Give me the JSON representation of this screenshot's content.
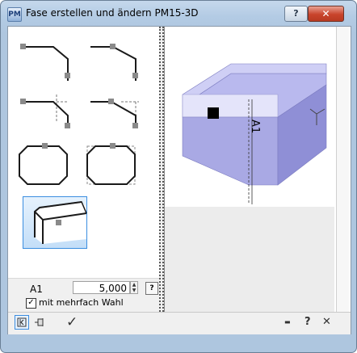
{
  "window": {
    "title": "Fase erstellen und ändern  PM15-3D",
    "app_icon": "PM",
    "help_label": "?",
    "close_label": "✕"
  },
  "tiles": [
    {
      "name": "chamfer-corner-top-left",
      "selected": false
    },
    {
      "name": "chamfer-corner-top-right",
      "selected": false
    },
    {
      "name": "chamfer-corner-dashed-left",
      "selected": false
    },
    {
      "name": "chamfer-corner-dashed-right",
      "selected": false
    },
    {
      "name": "chamfer-octagon",
      "selected": false
    },
    {
      "name": "chamfer-octagon-dashed",
      "selected": false
    },
    {
      "name": "chamfer-3d-edge",
      "selected": true
    }
  ],
  "params": {
    "a1_label": "A1",
    "a1_value": "5,000",
    "help_label": "?",
    "multi_select_checked": true,
    "multi_select_label": "mit mehrfach Wahl"
  },
  "viewport": {
    "dimension_label": "A1",
    "body_color": "#a9a9e4"
  },
  "toolbar": {
    "back_icon": "collapse-panel-icon",
    "pin_icon": "pin-icon",
    "ok_label": "✓",
    "minimize_label": "▬",
    "help_label": "?",
    "close_label": "✕"
  }
}
